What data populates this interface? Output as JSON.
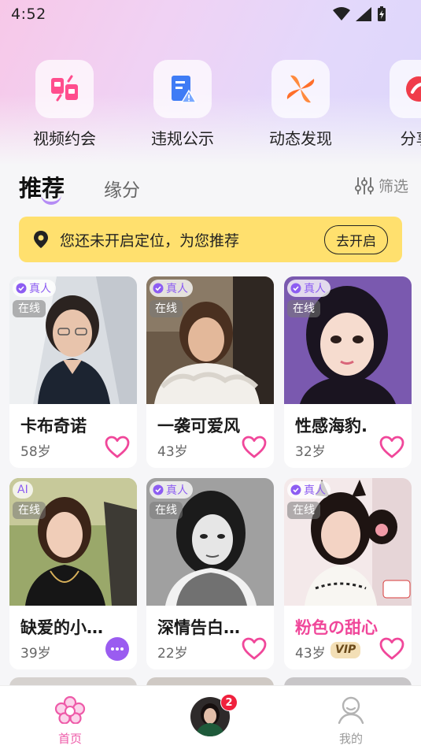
{
  "status_bar": {
    "time": "4:52"
  },
  "quick_links": [
    {
      "label": "视频约会",
      "icon": "video-date-icon"
    },
    {
      "label": "违规公示",
      "icon": "violation-notice-icon"
    },
    {
      "label": "动态发现",
      "icon": "pinwheel-icon"
    },
    {
      "label": "分享/",
      "icon": "share-icon"
    }
  ],
  "tabs": {
    "active": "推荐",
    "inactive": "缘分",
    "filter_label": "筛选"
  },
  "location_banner": {
    "text": "您还未开启定位，为您推荐",
    "button": "去开启"
  },
  "cards": [
    {
      "name": "卡布奇诺",
      "age": "58岁",
      "badge": "真人",
      "online": "在线",
      "action": "heart-icon"
    },
    {
      "name": "一袭可爱风",
      "age": "43岁",
      "badge": "真人",
      "online": "在线",
      "action": "heart-icon"
    },
    {
      "name": "性感海豹.",
      "age": "32岁",
      "badge": "真人",
      "online": "在线",
      "action": "heart-icon"
    },
    {
      "name": "缺爱的小雨...",
      "age": "39岁",
      "badge": "AI",
      "online": "在线",
      "action": "chat-bubble-icon"
    },
    {
      "name": "深情告白给...",
      "age": "22岁",
      "badge": "真人",
      "online": "在线",
      "action": "heart-icon"
    },
    {
      "name": "粉色の甜心",
      "age": "43岁",
      "badge": "真人",
      "online": "在线",
      "vip": "VIP",
      "action": "heart-icon"
    }
  ],
  "bottom_nav": {
    "home_label": "首页",
    "message_count": "2",
    "mine_label": "我的"
  },
  "colors": {
    "accent_purple": "#8d5df2",
    "heart_pink": "#f0479a",
    "banner_yellow": "#ffe06e",
    "badge_red": "#f0213d"
  }
}
